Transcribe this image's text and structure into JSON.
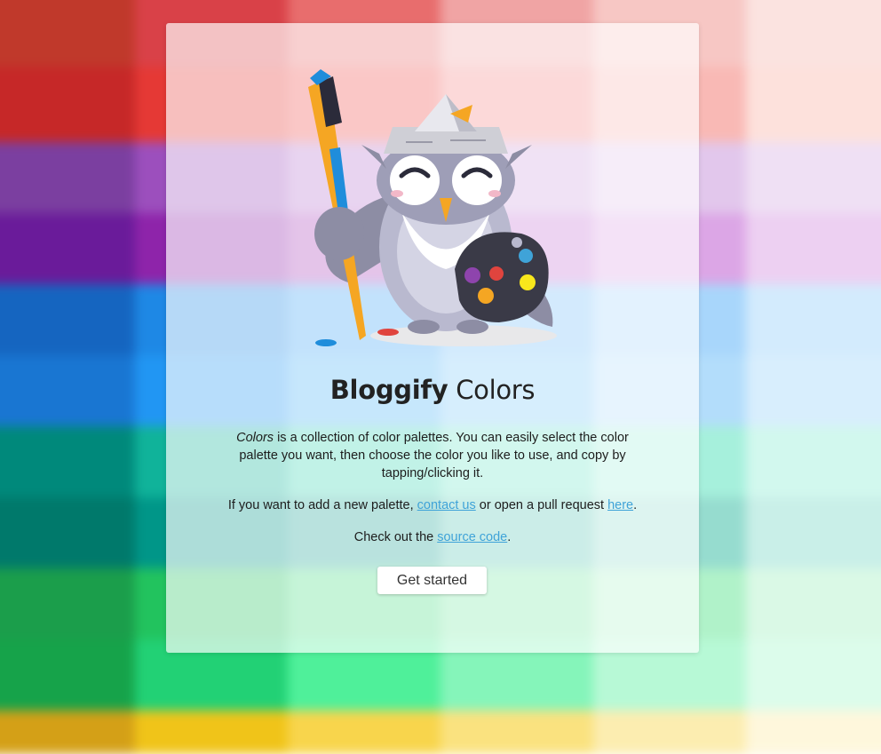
{
  "background_palette": {
    "rows": [
      [
        "#c0392b",
        "#d94148",
        "#e86d6d",
        "#f0a4a4",
        "#f7c7c4",
        "#fbe3e0"
      ],
      [
        "#c62828",
        "#e53935",
        "#ef5350",
        "#f48a8a",
        "#f9b9b5",
        "#fde1dc"
      ],
      [
        "#7b3fa0",
        "#9c4fbd",
        "#b87ad0",
        "#cfa6e0",
        "#e2c7ec",
        "#efe0f4"
      ],
      [
        "#6a1b9a",
        "#8e24aa",
        "#ab47bc",
        "#c77ad6",
        "#dca6e6",
        "#edd0f2"
      ],
      [
        "#1565c0",
        "#1e88e5",
        "#42a5f5",
        "#76bff8",
        "#a8d6fb",
        "#d3ebfd"
      ],
      [
        "#1976d2",
        "#2196f3",
        "#4fb3f6",
        "#80c9f8",
        "#b3ddfb",
        "#d8eefd"
      ],
      [
        "#00897b",
        "#10b39a",
        "#3fd6b4",
        "#73e6c9",
        "#a6f0dc",
        "#d2f8ee"
      ],
      [
        "#00796b",
        "#009688",
        "#26a69a",
        "#5ec7b6",
        "#96dccf",
        "#c9efe8"
      ],
      [
        "#1b9e4b",
        "#22c35e",
        "#4ede86",
        "#7ee9a7",
        "#b0f2c9",
        "#daf9e6"
      ],
      [
        "#16a34a",
        "#22d175",
        "#4ff09a",
        "#85f5ba",
        "#b7f9d6",
        "#dcfceb"
      ],
      [
        "#d4a017",
        "#f0c419",
        "#f8d54c",
        "#fae27f",
        "#fcedb0",
        "#fef7dc"
      ]
    ]
  },
  "card": {
    "mascot_name": "owl-painter-icon",
    "title_brand": "Bloggify",
    "title_sub": " Colors",
    "desc_em": "Colors",
    "desc_rest": " is a collection of color palettes. You can easily select the color palette you want, then choose the color you like to use, and copy by tapping/clicking it.",
    "p2_before": "If you want to add a new palette, ",
    "p2_link1": "contact us",
    "p2_middle": " or open a pull request ",
    "p2_link2": "here",
    "p2_after": ".",
    "p3_before": "Check out the ",
    "p3_link": "source code",
    "p3_after": ".",
    "button_label": "Get started"
  }
}
